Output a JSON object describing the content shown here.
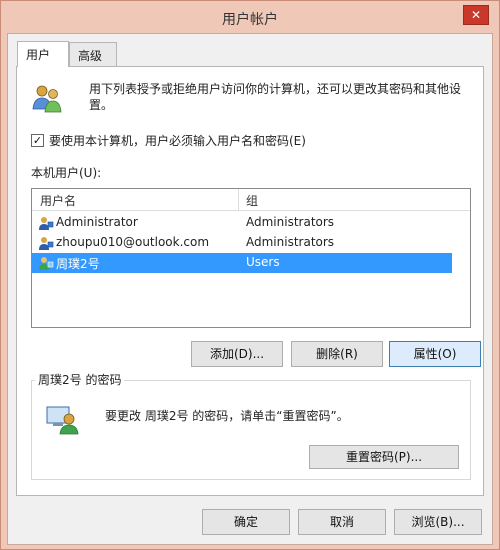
{
  "window": {
    "title": "用户帐户",
    "close_label": "✕"
  },
  "tabs": [
    {
      "label": "用户",
      "selected": true
    },
    {
      "label": "高级",
      "selected": false
    }
  ],
  "intro": {
    "text": "用下列表授予或拒绝用户访问你的计算机，还可以更改其密码和其他设置。",
    "icon": "users-icon"
  },
  "require_login": {
    "label": "要使用本计算机，用户必须输入用户名和密码(E)",
    "checked": true,
    "check_glyph": "✓"
  },
  "local_users": {
    "label": "本机用户(U):",
    "columns": [
      "用户名",
      "组"
    ],
    "rows": [
      {
        "name": "Administrator",
        "group": "Administrators",
        "selected": false
      },
      {
        "name": "zhoupu010@outlook.com",
        "group": "Administrators",
        "selected": false
      },
      {
        "name": "周璞2号",
        "group": "Users",
        "selected": true
      }
    ],
    "selection_color": "#3399ff"
  },
  "buttons": {
    "add": "添加(D)...",
    "delete": "删除(R)",
    "properties": "属性(O)",
    "reset_password": "重置密码(P)...",
    "ok": "确定",
    "cancel": "取消",
    "browse": "浏览(B)..."
  },
  "password_group": {
    "title": "周璞2号 的密码",
    "text": "要更改 周璞2号 的密码，请单击“重置密码”。",
    "icon": "password-user-icon"
  }
}
